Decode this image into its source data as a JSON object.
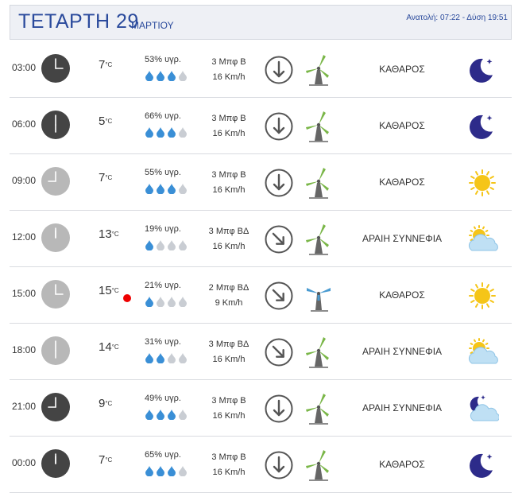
{
  "header": {
    "day": "ΤΕΤΑΡΤΗ 29",
    "month": "ΜΑΡΤΙΟΥ",
    "sun": "Ανατολή: 07:22  - Δύση 19:51"
  },
  "unit_symbol": "°C",
  "colors": {
    "accent": "#2a4a9c",
    "drop_full": "#3a8fd6",
    "drop_empty": "#c9cdd3",
    "turbine": "#7ab648",
    "turbine_alt": "#4a9bd1",
    "moon": "#2d2b8a",
    "sun": "#f5c518"
  },
  "rows": [
    {
      "time": "03:00",
      "hour": 3,
      "night": true,
      "temp": "7",
      "hum": "53% υγρ.",
      "drops": 3,
      "wind": "3 Μπφ Β",
      "speed": "16 Km/h",
      "dir": "north",
      "turbine_color": "green",
      "desc": "ΚΑΘΑΡΟΣ",
      "icon": "moon-icon",
      "alert": false
    },
    {
      "time": "06:00",
      "hour": 6,
      "night": true,
      "temp": "5",
      "hum": "66% υγρ.",
      "drops": 3,
      "wind": "3 Μπφ Β",
      "speed": "16 Km/h",
      "dir": "north",
      "turbine_color": "green",
      "desc": "ΚΑΘΑΡΟΣ",
      "icon": "moon-icon",
      "alert": false
    },
    {
      "time": "09:00",
      "hour": 9,
      "night": false,
      "temp": "7",
      "hum": "55% υγρ.",
      "drops": 3,
      "wind": "3 Μπφ Β",
      "speed": "16 Km/h",
      "dir": "north",
      "turbine_color": "green",
      "desc": "ΚΑΘΑΡΟΣ",
      "icon": "sun-icon",
      "alert": false
    },
    {
      "time": "12:00",
      "hour": 12,
      "night": false,
      "temp": "13",
      "hum": "19% υγρ.",
      "drops": 1,
      "wind": "3 Μπφ ΒΔ",
      "speed": "16 Km/h",
      "dir": "northwest",
      "turbine_color": "green",
      "desc": "ΑΡΑΙΗ ΣΥΝΝΕΦΙΑ",
      "icon": "sun-cloud-icon",
      "alert": false
    },
    {
      "time": "15:00",
      "hour": 15,
      "night": false,
      "temp": "15",
      "hum": "21% υγρ.",
      "drops": 1,
      "wind": "2 Μπφ ΒΔ",
      "speed": "9 Km/h",
      "dir": "northwest",
      "turbine_color": "blue",
      "desc": "ΚΑΘΑΡΟΣ",
      "icon": "sun-icon",
      "alert": true
    },
    {
      "time": "18:00",
      "hour": 18,
      "night": false,
      "temp": "14",
      "hum": "31% υγρ.",
      "drops": 2,
      "wind": "3 Μπφ ΒΔ",
      "speed": "16 Km/h",
      "dir": "northwest",
      "turbine_color": "green",
      "desc": "ΑΡΑΙΗ ΣΥΝΝΕΦΙΑ",
      "icon": "sun-cloud-icon",
      "alert": false
    },
    {
      "time": "21:00",
      "hour": 21,
      "night": true,
      "temp": "9",
      "hum": "49% υγρ.",
      "drops": 3,
      "wind": "3 Μπφ Β",
      "speed": "16 Km/h",
      "dir": "north",
      "turbine_color": "green",
      "desc": "ΑΡΑΙΗ ΣΥΝΝΕΦΙΑ",
      "icon": "moon-cloud-icon",
      "alert": false
    },
    {
      "time": "00:00",
      "hour": 0,
      "night": true,
      "temp": "7",
      "hum": "65% υγρ.",
      "drops": 3,
      "wind": "3 Μπφ Β",
      "speed": "16 Km/h",
      "dir": "north",
      "turbine_color": "green",
      "desc": "ΚΑΘΑΡΟΣ",
      "icon": "moon-icon",
      "alert": false
    }
  ]
}
